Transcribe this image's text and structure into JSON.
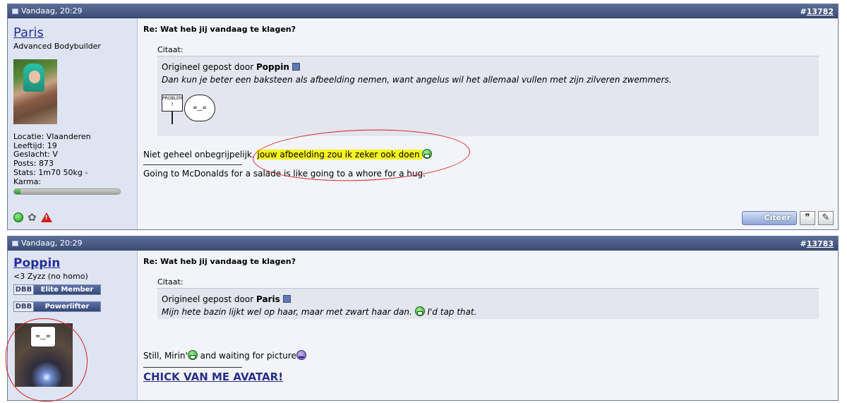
{
  "posts": [
    {
      "time": "Vandaag, 20:29",
      "number_prefix": "#",
      "number": "13782",
      "user": {
        "name": "Paris",
        "title": "Advanced Bodybuilder",
        "stats": [
          "Locatie: Vlaanderen",
          "Leeftijd: 19",
          "Geslacht: V",
          "Posts: 873",
          "Stats: 1m70 50kg -",
          "Karma:"
        ],
        "karma_level": 0.06
      },
      "title": "Re: Wat heb jij vandaag te klagen?",
      "quote": {
        "label": "Citaat:",
        "by_prefix": "Origineel gepost door",
        "by": "Poppin",
        "text": "Dan kun je beter een baksteen als afbeelding nemen, want angelus wil het allemaal vullen met zijn zilveren zwemmers.",
        "image_sign": "PROBLEM ?"
      },
      "body_before": "Niet geheel onbegrijpelijk, ",
      "body_highlight": "jouw afbeelding zou ik zeker ook doen",
      "signature": "Going to McDonalds for a salade is like going to a whore for a hug.",
      "buttons": {
        "quote": "Citeer"
      }
    },
    {
      "time": "Vandaag, 20:29",
      "number_prefix": "#",
      "number": "13783",
      "user": {
        "name": "Poppin",
        "title": "<3 Zyzz (no homo)",
        "badges": [
          {
            "left": "DBB",
            "right": "Elite Member"
          },
          {
            "left": "DBB",
            "right": "Powerlifter"
          }
        ]
      },
      "title": "Re: Wat heb jij vandaag te klagen?",
      "quote": {
        "label": "Citaat:",
        "by_prefix": "Origineel gepost door",
        "by": "Paris",
        "text_before": "Mijn hete bazin lijkt wel op haar, maar met zwart haar dan.",
        "text_after": " I'd tap that."
      },
      "body_before": "Still, Mirin'",
      "body_after": " and waiting for picture",
      "signature": "CHICK VAN ME AVATAR!"
    }
  ],
  "colors": {
    "header": "#3b4d78",
    "highlight": "#f6f41a",
    "annotation_circle": "#d81e1e",
    "username": "#22309b"
  }
}
